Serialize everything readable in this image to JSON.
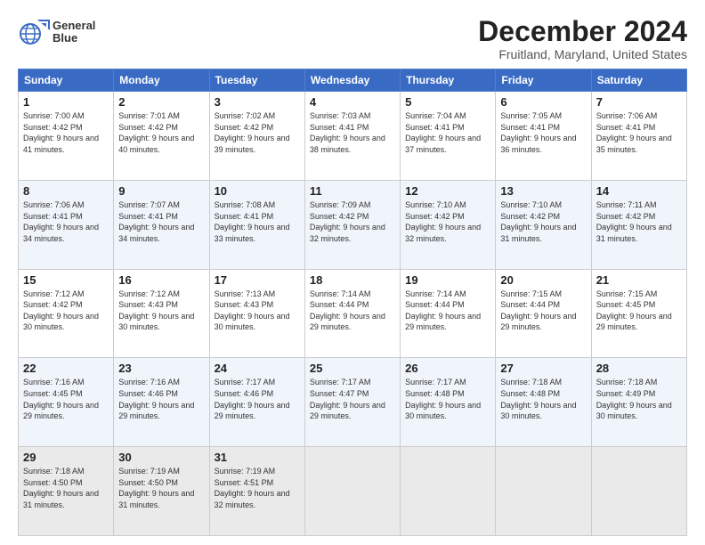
{
  "logo": {
    "line1": "General",
    "line2": "Blue"
  },
  "title": "December 2024",
  "subtitle": "Fruitland, Maryland, United States",
  "weekdays": [
    "Sunday",
    "Monday",
    "Tuesday",
    "Wednesday",
    "Thursday",
    "Friday",
    "Saturday"
  ],
  "weeks": [
    [
      {
        "day": "1",
        "sunrise": "Sunrise: 7:00 AM",
        "sunset": "Sunset: 4:42 PM",
        "daylight": "Daylight: 9 hours and 41 minutes."
      },
      {
        "day": "2",
        "sunrise": "Sunrise: 7:01 AM",
        "sunset": "Sunset: 4:42 PM",
        "daylight": "Daylight: 9 hours and 40 minutes."
      },
      {
        "day": "3",
        "sunrise": "Sunrise: 7:02 AM",
        "sunset": "Sunset: 4:42 PM",
        "daylight": "Daylight: 9 hours and 39 minutes."
      },
      {
        "day": "4",
        "sunrise": "Sunrise: 7:03 AM",
        "sunset": "Sunset: 4:41 PM",
        "daylight": "Daylight: 9 hours and 38 minutes."
      },
      {
        "day": "5",
        "sunrise": "Sunrise: 7:04 AM",
        "sunset": "Sunset: 4:41 PM",
        "daylight": "Daylight: 9 hours and 37 minutes."
      },
      {
        "day": "6",
        "sunrise": "Sunrise: 7:05 AM",
        "sunset": "Sunset: 4:41 PM",
        "daylight": "Daylight: 9 hours and 36 minutes."
      },
      {
        "day": "7",
        "sunrise": "Sunrise: 7:06 AM",
        "sunset": "Sunset: 4:41 PM",
        "daylight": "Daylight: 9 hours and 35 minutes."
      }
    ],
    [
      {
        "day": "8",
        "sunrise": "Sunrise: 7:06 AM",
        "sunset": "Sunset: 4:41 PM",
        "daylight": "Daylight: 9 hours and 34 minutes."
      },
      {
        "day": "9",
        "sunrise": "Sunrise: 7:07 AM",
        "sunset": "Sunset: 4:41 PM",
        "daylight": "Daylight: 9 hours and 34 minutes."
      },
      {
        "day": "10",
        "sunrise": "Sunrise: 7:08 AM",
        "sunset": "Sunset: 4:41 PM",
        "daylight": "Daylight: 9 hours and 33 minutes."
      },
      {
        "day": "11",
        "sunrise": "Sunrise: 7:09 AM",
        "sunset": "Sunset: 4:42 PM",
        "daylight": "Daylight: 9 hours and 32 minutes."
      },
      {
        "day": "12",
        "sunrise": "Sunrise: 7:10 AM",
        "sunset": "Sunset: 4:42 PM",
        "daylight": "Daylight: 9 hours and 32 minutes."
      },
      {
        "day": "13",
        "sunrise": "Sunrise: 7:10 AM",
        "sunset": "Sunset: 4:42 PM",
        "daylight": "Daylight: 9 hours and 31 minutes."
      },
      {
        "day": "14",
        "sunrise": "Sunrise: 7:11 AM",
        "sunset": "Sunset: 4:42 PM",
        "daylight": "Daylight: 9 hours and 31 minutes."
      }
    ],
    [
      {
        "day": "15",
        "sunrise": "Sunrise: 7:12 AM",
        "sunset": "Sunset: 4:42 PM",
        "daylight": "Daylight: 9 hours and 30 minutes."
      },
      {
        "day": "16",
        "sunrise": "Sunrise: 7:12 AM",
        "sunset": "Sunset: 4:43 PM",
        "daylight": "Daylight: 9 hours and 30 minutes."
      },
      {
        "day": "17",
        "sunrise": "Sunrise: 7:13 AM",
        "sunset": "Sunset: 4:43 PM",
        "daylight": "Daylight: 9 hours and 30 minutes."
      },
      {
        "day": "18",
        "sunrise": "Sunrise: 7:14 AM",
        "sunset": "Sunset: 4:44 PM",
        "daylight": "Daylight: 9 hours and 29 minutes."
      },
      {
        "day": "19",
        "sunrise": "Sunrise: 7:14 AM",
        "sunset": "Sunset: 4:44 PM",
        "daylight": "Daylight: 9 hours and 29 minutes."
      },
      {
        "day": "20",
        "sunrise": "Sunrise: 7:15 AM",
        "sunset": "Sunset: 4:44 PM",
        "daylight": "Daylight: 9 hours and 29 minutes."
      },
      {
        "day": "21",
        "sunrise": "Sunrise: 7:15 AM",
        "sunset": "Sunset: 4:45 PM",
        "daylight": "Daylight: 9 hours and 29 minutes."
      }
    ],
    [
      {
        "day": "22",
        "sunrise": "Sunrise: 7:16 AM",
        "sunset": "Sunset: 4:45 PM",
        "daylight": "Daylight: 9 hours and 29 minutes."
      },
      {
        "day": "23",
        "sunrise": "Sunrise: 7:16 AM",
        "sunset": "Sunset: 4:46 PM",
        "daylight": "Daylight: 9 hours and 29 minutes."
      },
      {
        "day": "24",
        "sunrise": "Sunrise: 7:17 AM",
        "sunset": "Sunset: 4:46 PM",
        "daylight": "Daylight: 9 hours and 29 minutes."
      },
      {
        "day": "25",
        "sunrise": "Sunrise: 7:17 AM",
        "sunset": "Sunset: 4:47 PM",
        "daylight": "Daylight: 9 hours and 29 minutes."
      },
      {
        "day": "26",
        "sunrise": "Sunrise: 7:17 AM",
        "sunset": "Sunset: 4:48 PM",
        "daylight": "Daylight: 9 hours and 30 minutes."
      },
      {
        "day": "27",
        "sunrise": "Sunrise: 7:18 AM",
        "sunset": "Sunset: 4:48 PM",
        "daylight": "Daylight: 9 hours and 30 minutes."
      },
      {
        "day": "28",
        "sunrise": "Sunrise: 7:18 AM",
        "sunset": "Sunset: 4:49 PM",
        "daylight": "Daylight: 9 hours and 30 minutes."
      }
    ],
    [
      {
        "day": "29",
        "sunrise": "Sunrise: 7:18 AM",
        "sunset": "Sunset: 4:50 PM",
        "daylight": "Daylight: 9 hours and 31 minutes."
      },
      {
        "day": "30",
        "sunrise": "Sunrise: 7:19 AM",
        "sunset": "Sunset: 4:50 PM",
        "daylight": "Daylight: 9 hours and 31 minutes."
      },
      {
        "day": "31",
        "sunrise": "Sunrise: 7:19 AM",
        "sunset": "Sunset: 4:51 PM",
        "daylight": "Daylight: 9 hours and 32 minutes."
      },
      null,
      null,
      null,
      null
    ]
  ]
}
